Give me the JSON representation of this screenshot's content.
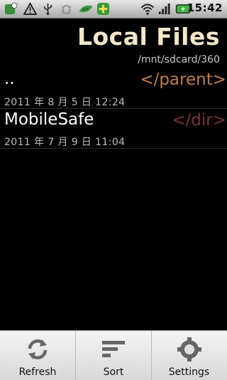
{
  "status": {
    "time": "15:42",
    "icons": [
      "app-badge-icon",
      "warning-icon",
      "usb-icon",
      "bug-icon",
      "peapod-icon",
      "plus-badge-icon",
      "wifi-icon",
      "signal-icon",
      "battery-icon"
    ]
  },
  "header": {
    "title": "Local Files",
    "path": "/mnt/sdcard/360"
  },
  "rows": [
    {
      "name": "..",
      "tag": "</parent>",
      "tag_color": "#c07d4c",
      "date": "2011 年 8 月 5 日 12:24"
    },
    {
      "name": "MobileSafe",
      "tag": "</dir>",
      "tag_color": "#7a3534",
      "date": "2011 年 7 月 9 日 11:04"
    }
  ],
  "toolbar": {
    "refresh_label": "Refresh",
    "sort_label": "Sort",
    "settings_label": "Settings"
  }
}
